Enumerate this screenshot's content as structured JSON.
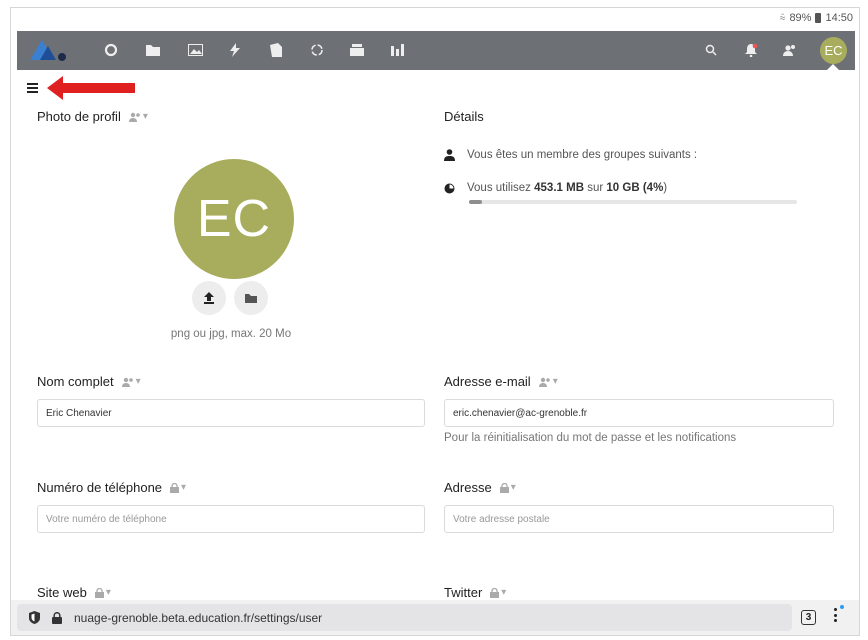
{
  "status_bar": {
    "battery": "89%",
    "time": "14:50"
  },
  "header": {
    "app_icons": [
      "dashboard-icon",
      "files-icon",
      "photos-icon",
      "activity-icon",
      "notes-icon",
      "circles-icon",
      "deck-icon",
      "stats-icon"
    ],
    "right_icons": [
      "search-icon",
      "notifications-icon",
      "contacts-icon"
    ],
    "avatar_initials": "EC",
    "avatar_color": "#a8ad5d"
  },
  "profile_photo": {
    "title": "Photo de profil",
    "initials": "EC",
    "hint": "png ou jpg, max. 20 Mo"
  },
  "details": {
    "title": "Détails",
    "groups_text": "Vous êtes un membre des groupes suivants :",
    "usage_prefix": "Vous utilisez",
    "usage_used": "453.1 MB",
    "usage_mid": "sur",
    "usage_total": "10 GB",
    "usage_percent_label": "(4%",
    "usage_suffix": ")",
    "usage_fraction": 0.04
  },
  "fullname": {
    "label": "Nom complet",
    "value": "Eric Chenavier"
  },
  "email": {
    "label": "Adresse e-mail",
    "value": "eric.chenavier@ac-grenoble.fr",
    "help": "Pour la réinitialisation du mot de passe et les notifications"
  },
  "phone": {
    "label": "Numéro de téléphone",
    "placeholder": "Votre numéro de téléphone"
  },
  "address": {
    "label": "Adresse",
    "placeholder": "Votre adresse postale"
  },
  "website": {
    "label": "Site web"
  },
  "twitter": {
    "label": "Twitter"
  },
  "browser": {
    "url": "nuage-grenoble.beta.education.fr/settings/user",
    "tab_count": "3"
  },
  "colors": {
    "header_bg": "#6d7075",
    "accent_red": "#e02020"
  }
}
